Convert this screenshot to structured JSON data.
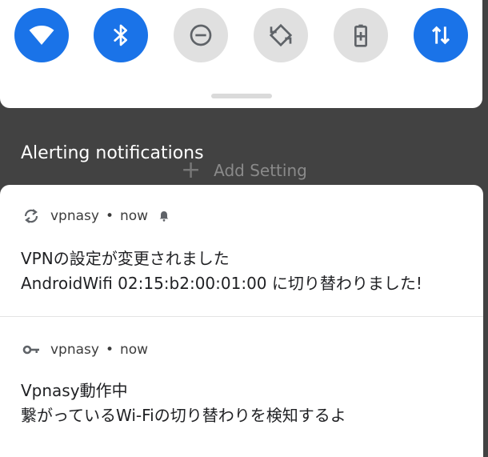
{
  "quick_settings": {
    "tiles": [
      {
        "name": "wifi-icon",
        "state": "on"
      },
      {
        "name": "bluetooth-icon",
        "state": "on"
      },
      {
        "name": "do-not-disturb-icon",
        "state": "off"
      },
      {
        "name": "auto-rotate-icon",
        "state": "off"
      },
      {
        "name": "battery-saver-icon",
        "state": "off"
      },
      {
        "name": "mobile-data-icon",
        "state": "on"
      }
    ],
    "accent_color": "#1a73e8"
  },
  "shade": {
    "section_header": "Alerting notifications",
    "add_setting_label": "Add Setting"
  },
  "notifications": [
    {
      "app_name": "vpnasy",
      "time": "now",
      "icon": "sync-icon",
      "alerting": true,
      "title": "VPNの設定が変更されました",
      "text": "AndroidWifi 02:15:b2:00:01:00 に切り替わりました!"
    },
    {
      "app_name": "vpnasy",
      "time": "now",
      "icon": "key-icon",
      "alerting": false,
      "title": "Vpnasy動作中",
      "text": "繋がっているWi-Fiの切り替わりを検知するよ"
    }
  ]
}
